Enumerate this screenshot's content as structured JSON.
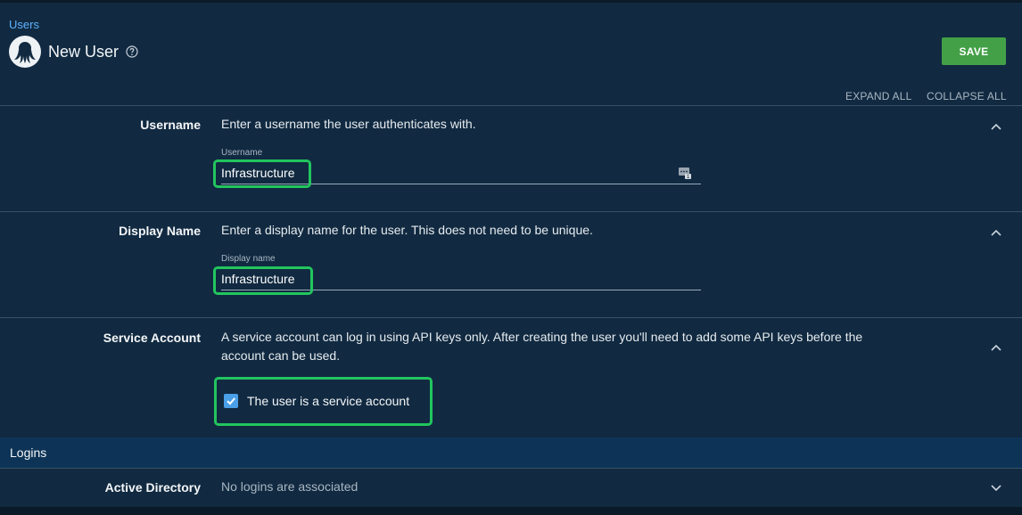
{
  "breadcrumb": "Users",
  "header": {
    "title": "New User",
    "save_label": "SAVE",
    "expand_all": "EXPAND ALL",
    "collapse_all": "COLLAPSE ALL"
  },
  "sections": {
    "username": {
      "label": "Username",
      "description": "Enter a username the user authenticates with.",
      "field_label": "Username",
      "value": "Infrastructure"
    },
    "display_name": {
      "label": "Display Name",
      "description": "Enter a display name for the user. This does not need to be unique.",
      "field_label": "Display name",
      "value": "Infrastructure"
    },
    "service_account": {
      "label": "Service Account",
      "description_line1": "A service account can log in using API keys only. After creating the user you'll need to add some API keys before the",
      "description_line2": "account can be used.",
      "checkbox_label": "The user is a service account",
      "checked": true
    }
  },
  "logins": {
    "title": "Logins",
    "active_directory": {
      "label": "Active Directory",
      "status": "No logins are associated"
    }
  },
  "icons": {
    "avatar": "octopus-avatar-icon",
    "help": "help-circle-icon",
    "chevron_up": "chevron-up-icon",
    "chevron_down": "chevron-down-icon",
    "password_manager": "password-manager-icon",
    "check": "check-icon"
  },
  "colors": {
    "background": "#112a41",
    "accent_link": "#5eb3ff",
    "save_button": "#43a047",
    "highlight": "#22c55e",
    "checkbox": "#4a9fe8",
    "logins_bar": "#0d3456"
  }
}
